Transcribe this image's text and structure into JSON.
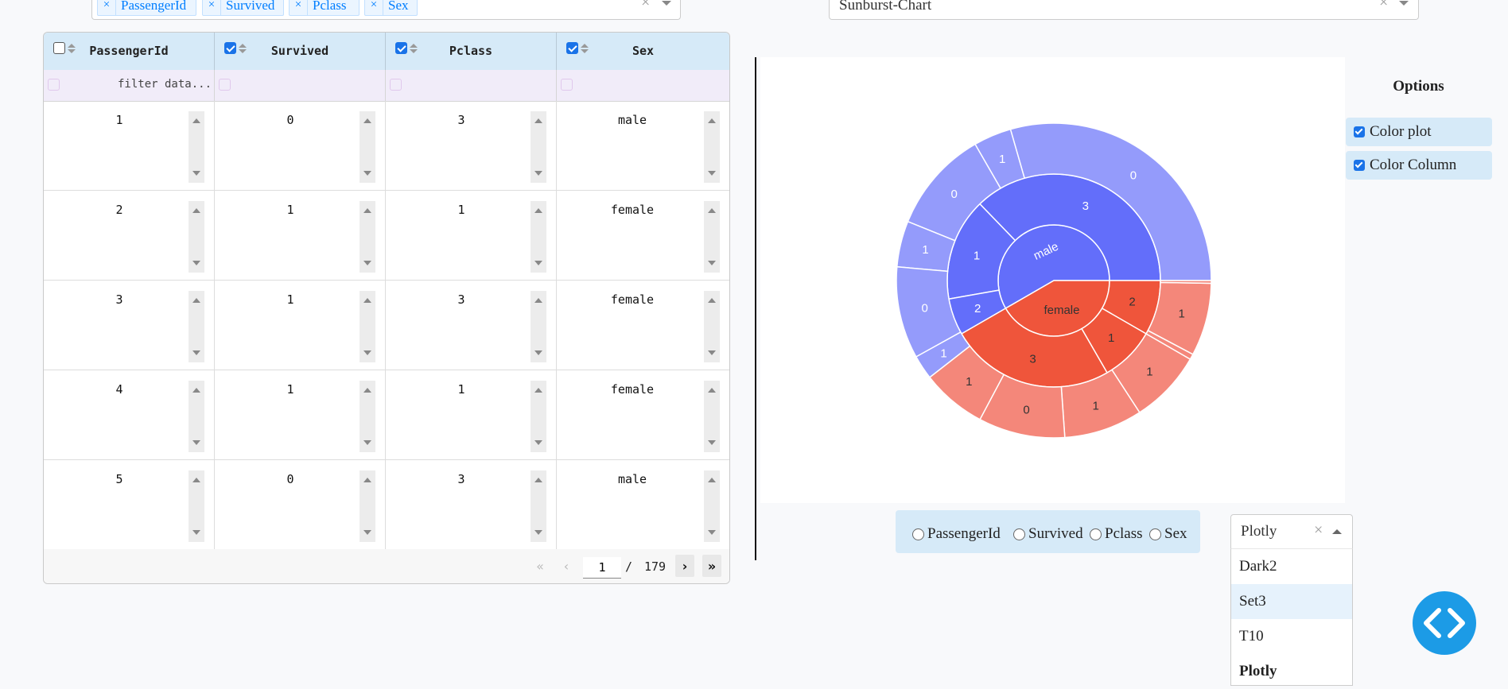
{
  "columns_select": {
    "chips": [
      "PassengerId",
      "Survived",
      "Pclass",
      "Sex"
    ]
  },
  "chart_type_select": {
    "value": "Sunburst-Chart"
  },
  "table": {
    "headers": [
      {
        "label": "PassengerId",
        "checked": false
      },
      {
        "label": "Survived",
        "checked": true
      },
      {
        "label": "Pclass",
        "checked": true
      },
      {
        "label": "Sex",
        "checked": true
      }
    ],
    "filter_placeholder": "filter data...",
    "rows": [
      [
        "1",
        "0",
        "3",
        "male"
      ],
      [
        "2",
        "1",
        "1",
        "female"
      ],
      [
        "3",
        "1",
        "3",
        "female"
      ],
      [
        "4",
        "1",
        "1",
        "female"
      ],
      [
        "5",
        "0",
        "3",
        "male"
      ]
    ],
    "pager": {
      "current_page": "1",
      "separator": "/",
      "total_pages": "179"
    }
  },
  "chart_data": {
    "type": "sunburst",
    "hierarchy": [
      "Sex",
      "Pclass",
      "Survived"
    ],
    "labels": {
      "center": [
        "male",
        "female"
      ],
      "male_pclass": [
        "3",
        "1",
        "2"
      ],
      "female_pclass": [
        "2",
        "1",
        "3"
      ],
      "male_survived": [
        "0",
        "1",
        "0",
        "1",
        "0",
        "1"
      ],
      "female_survived": [
        "1",
        "1",
        "1",
        "0",
        "1"
      ]
    },
    "colors": {
      "male_inner": "#636efa",
      "male_outer": "#949bfb",
      "female_inner": "#ef553b",
      "female_outer": "#f4877a",
      "border": "#ffffff"
    }
  },
  "options": {
    "title": "Options",
    "items": [
      {
        "label": "Color plot",
        "checked": true
      },
      {
        "label": "Color Column",
        "checked": true
      }
    ]
  },
  "color_by": {
    "options": [
      "PassengerId",
      "Survived",
      "Pclass",
      "Sex"
    ]
  },
  "palette": {
    "value": "Plotly",
    "options": [
      "Dark2",
      "Set3",
      "T10",
      "Plotly"
    ],
    "highlighted": "Set3"
  },
  "fab": {
    "icon": "code-icon"
  }
}
